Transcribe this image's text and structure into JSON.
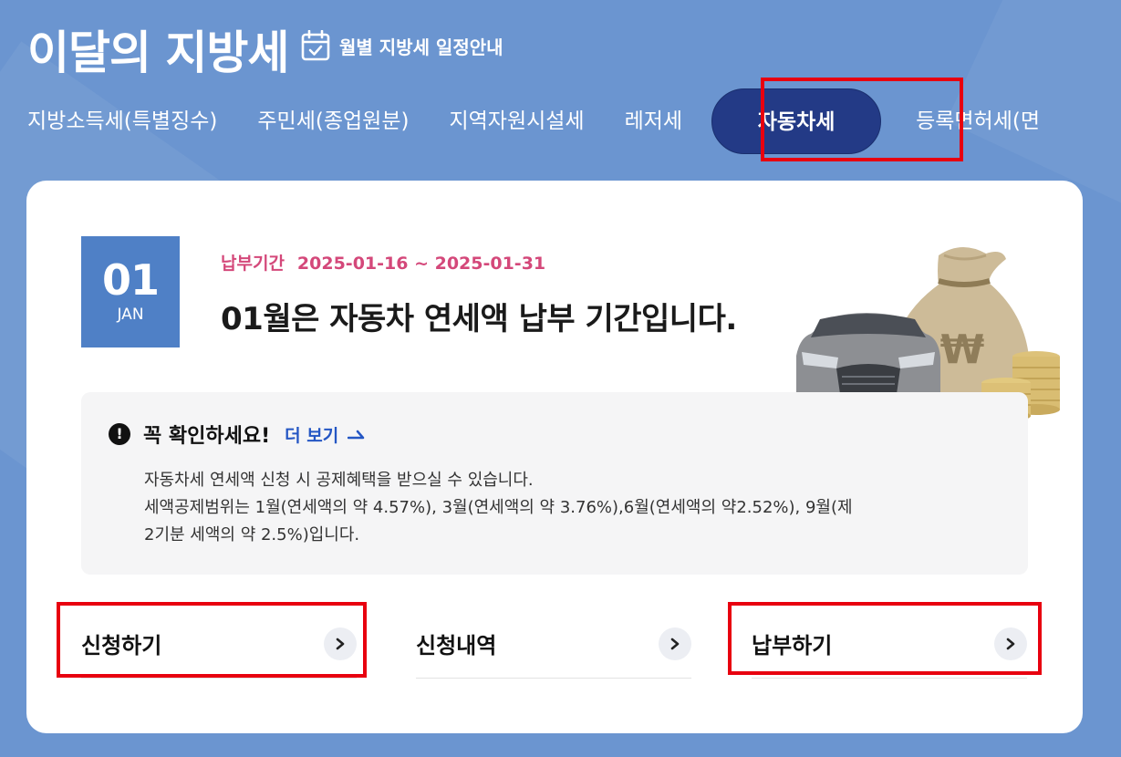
{
  "header": {
    "title": "이달의 지방세",
    "schedule_link": "월별 지방세 일정안내"
  },
  "tabs": [
    {
      "label": "지방소득세(특별징수)"
    },
    {
      "label": "주민세(종업원분)"
    },
    {
      "label": "지역자원시설세"
    },
    {
      "label": "레저세"
    },
    {
      "label": "자동차세"
    },
    {
      "label": "등록면허세(면"
    }
  ],
  "active_tab": "자동차세",
  "date": {
    "day": "01",
    "month": "JAN"
  },
  "period": {
    "label": "납부기간",
    "range": "2025-01-16 ~ 2025-01-31"
  },
  "headline": "01월은 자동차 연세액 납부 기간입니다.",
  "notice": {
    "title": "꼭 확인하세요!",
    "more_label": "더 보기",
    "lines": [
      "자동차세 연세액 신청 시 공제혜택을 받으실 수 있습니다.",
      "세액공제범위는 1월(연세액의 약 4.57%), 3월(연세액의 약 3.76%),6월(연세액의 약2.52%), 9월(제",
      "2기분 세액의 약 2.5%)입니다."
    ]
  },
  "actions": [
    {
      "label": "신청하기"
    },
    {
      "label": "신청내역"
    },
    {
      "label": "납부하기"
    }
  ],
  "colors": {
    "background": "#6b95d0",
    "active_tab": "#233a86",
    "date_box": "#4f80c6",
    "period_text": "#d4487a",
    "link": "#2456c4",
    "highlight": "#e8000f"
  },
  "illustration_mark": "₩"
}
